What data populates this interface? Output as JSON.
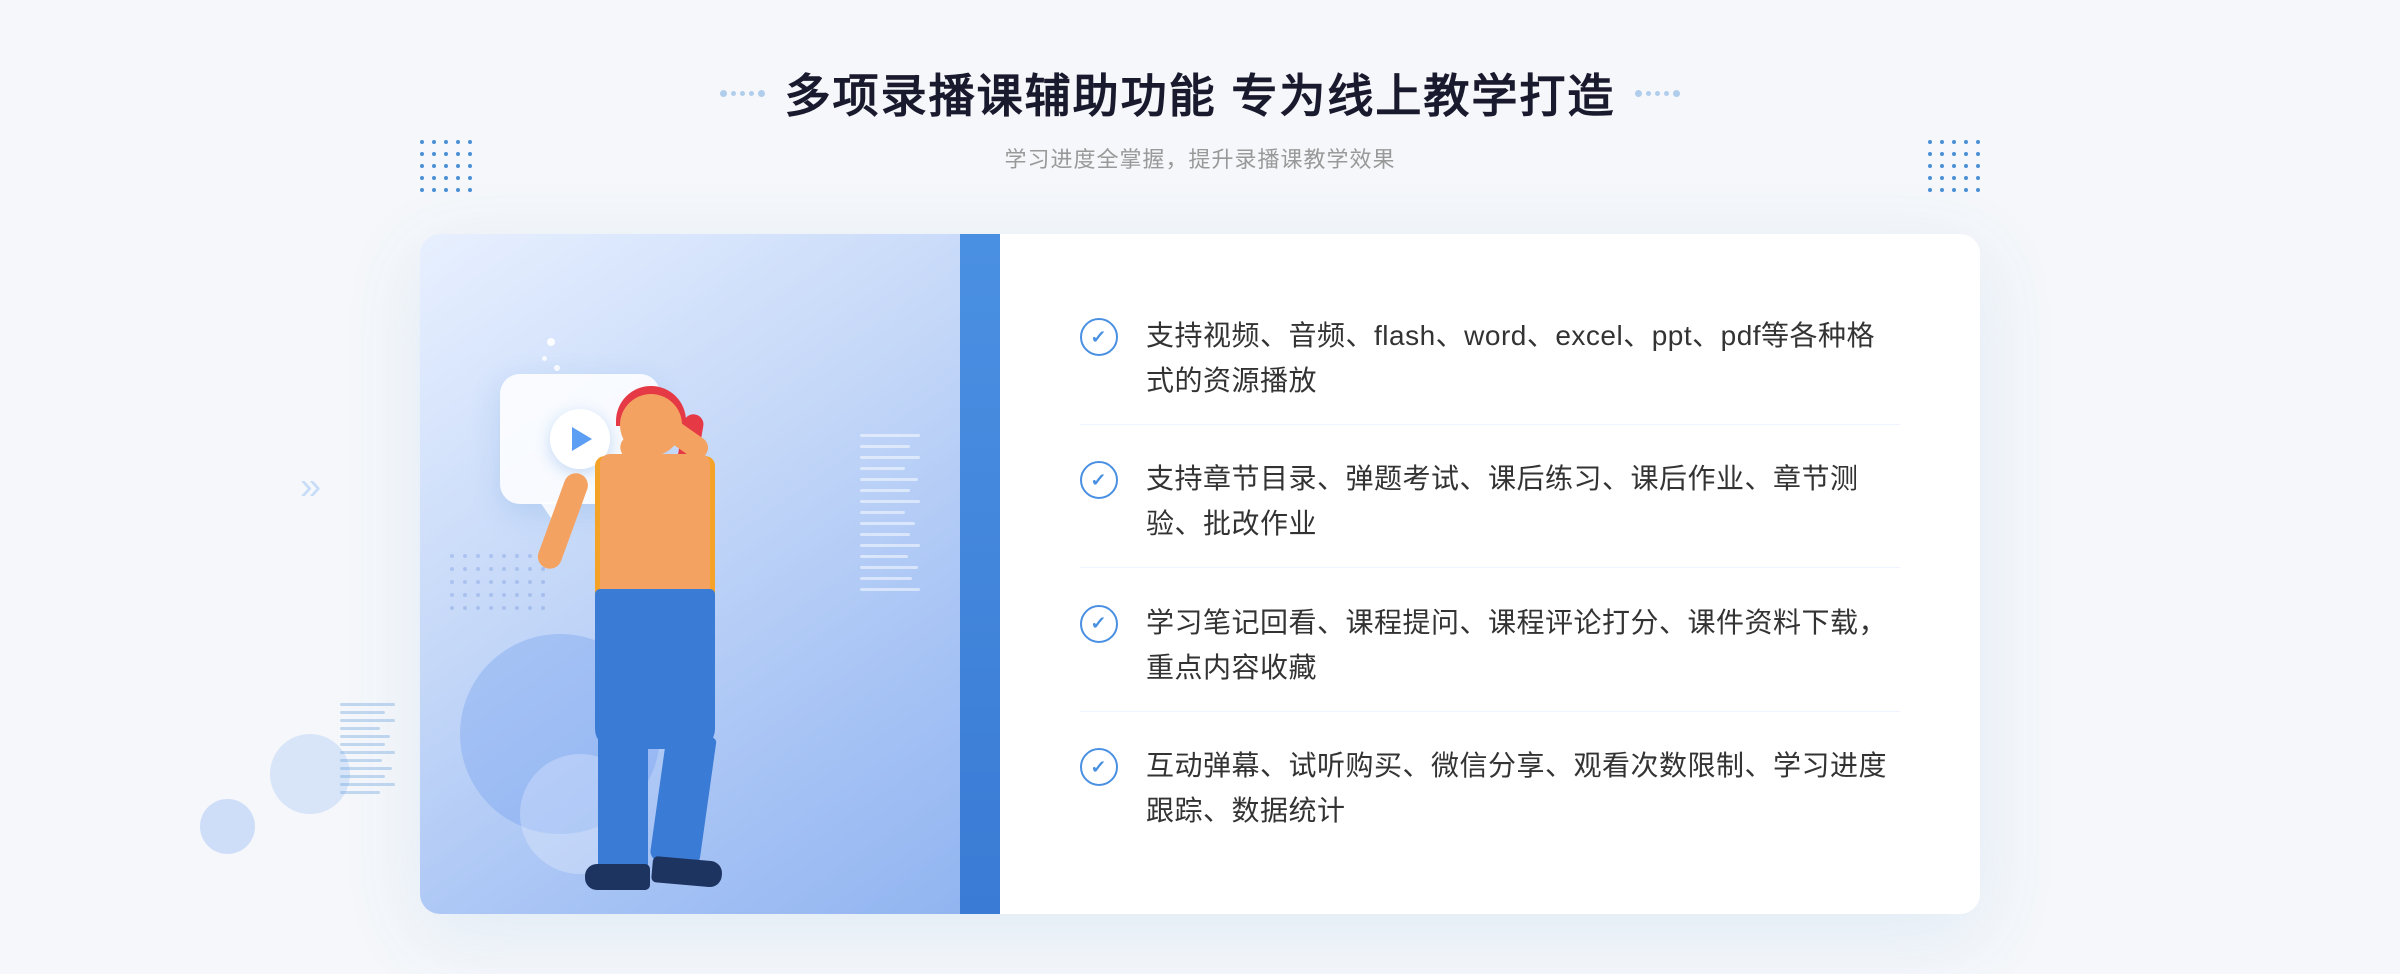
{
  "page": {
    "background_color": "#f5f7fa"
  },
  "header": {
    "title": "多项录播课辅助功能 专为线上教学打造",
    "subtitle": "学习进度全掌握，提升录播课教学效果"
  },
  "features": [
    {
      "id": 1,
      "text": "支持视频、音频、flash、word、excel、ppt、pdf等各种格式的资源播放"
    },
    {
      "id": 2,
      "text": "支持章节目录、弹题考试、课后练习、课后作业、章节测验、批改作业"
    },
    {
      "id": 3,
      "text": "学习笔记回看、课程提问、课程评论打分、课件资料下载，重点内容收藏"
    },
    {
      "id": 4,
      "text": "互动弹幕、试听购买、微信分享、观看次数限制、学习进度跟踪、数据统计"
    }
  ],
  "icons": {
    "check": "✓",
    "chevron_left": "《",
    "chevron_right": "》",
    "play": "▶"
  }
}
